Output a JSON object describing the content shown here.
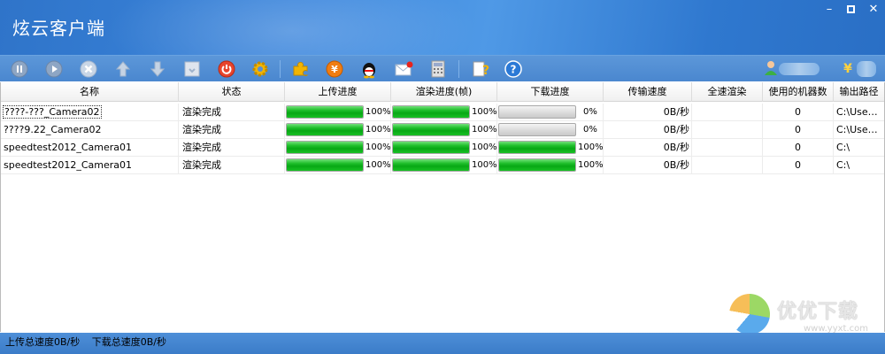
{
  "window": {
    "title": "炫云客户端",
    "controls": {
      "minimize": "–",
      "maximize": "□",
      "close": "✕"
    }
  },
  "toolbar": {
    "buttons": [
      {
        "name": "pause-icon",
        "color": "#8ea6c4"
      },
      {
        "name": "play-icon",
        "color": "#8ea6c4"
      },
      {
        "name": "cancel-icon",
        "color": "#b9c8dc"
      },
      {
        "name": "move-up-icon",
        "color": "#b9c8dc"
      },
      {
        "name": "move-down-icon",
        "color": "#b9c8dc"
      },
      {
        "name": "download-box-icon",
        "color": "#d7dde6"
      },
      {
        "name": "power-icon",
        "color": "#e8442d"
      },
      {
        "name": "settings-gear-icon",
        "color": "#f2b400"
      },
      {
        "name": "plugin-icon",
        "color": "#f2b400"
      },
      {
        "name": "recharge-yen-icon",
        "color": "#f07d12"
      },
      {
        "name": "qq-icon",
        "color": "#111111"
      },
      {
        "name": "message-icon",
        "color": "#ffffff"
      },
      {
        "name": "calculator-icon",
        "color": "#d9d9d9"
      },
      {
        "name": "help-doc-icon",
        "color": "#f2c200"
      },
      {
        "name": "about-icon",
        "color": "#2b79d6"
      }
    ],
    "user": {
      "user_icon": "user-icon",
      "balance_icon": "yen-icon"
    }
  },
  "table": {
    "columns": [
      "名称",
      "状态",
      "上传进度",
      "渲染进度(帧)",
      "下载进度",
      "传输速度",
      "全速渲染",
      "使用的机器数",
      "输出路径"
    ],
    "rows": [
      {
        "name": "????-???_Camera02",
        "status": "渲染完成",
        "upload": 100,
        "upload_label": "100%",
        "render": 100,
        "render_label": "100%",
        "download": 0,
        "download_label": "0%",
        "speed": "0B/秒",
        "fullspeed": "",
        "machines": "0",
        "path": "C:\\Use…"
      },
      {
        "name": "????9.22_Camera02",
        "status": "渲染完成",
        "upload": 100,
        "upload_label": "100%",
        "render": 100,
        "render_label": "100%",
        "download": 0,
        "download_label": "0%",
        "speed": "0B/秒",
        "fullspeed": "",
        "machines": "0",
        "path": "C:\\Use…"
      },
      {
        "name": "speedtest2012_Camera01",
        "status": "渲染完成",
        "upload": 100,
        "upload_label": "100%",
        "render": 100,
        "render_label": "100%",
        "download": 100,
        "download_label": "100%",
        "speed": "0B/秒",
        "fullspeed": "",
        "machines": "0",
        "path": "C:\\"
      },
      {
        "name": "speedtest2012_Camera01",
        "status": "渲染完成",
        "upload": 100,
        "upload_label": "100%",
        "render": 100,
        "render_label": "100%",
        "download": 100,
        "download_label": "100%",
        "speed": "0B/秒",
        "fullspeed": "",
        "machines": "0",
        "path": "C:\\"
      }
    ]
  },
  "statusbar": {
    "upload_speed": "上传总速度0B/秒",
    "download_speed": "下载总速度0B/秒"
  },
  "watermark": {
    "text": "优优下载",
    "url": "www.yyxt.com"
  }
}
